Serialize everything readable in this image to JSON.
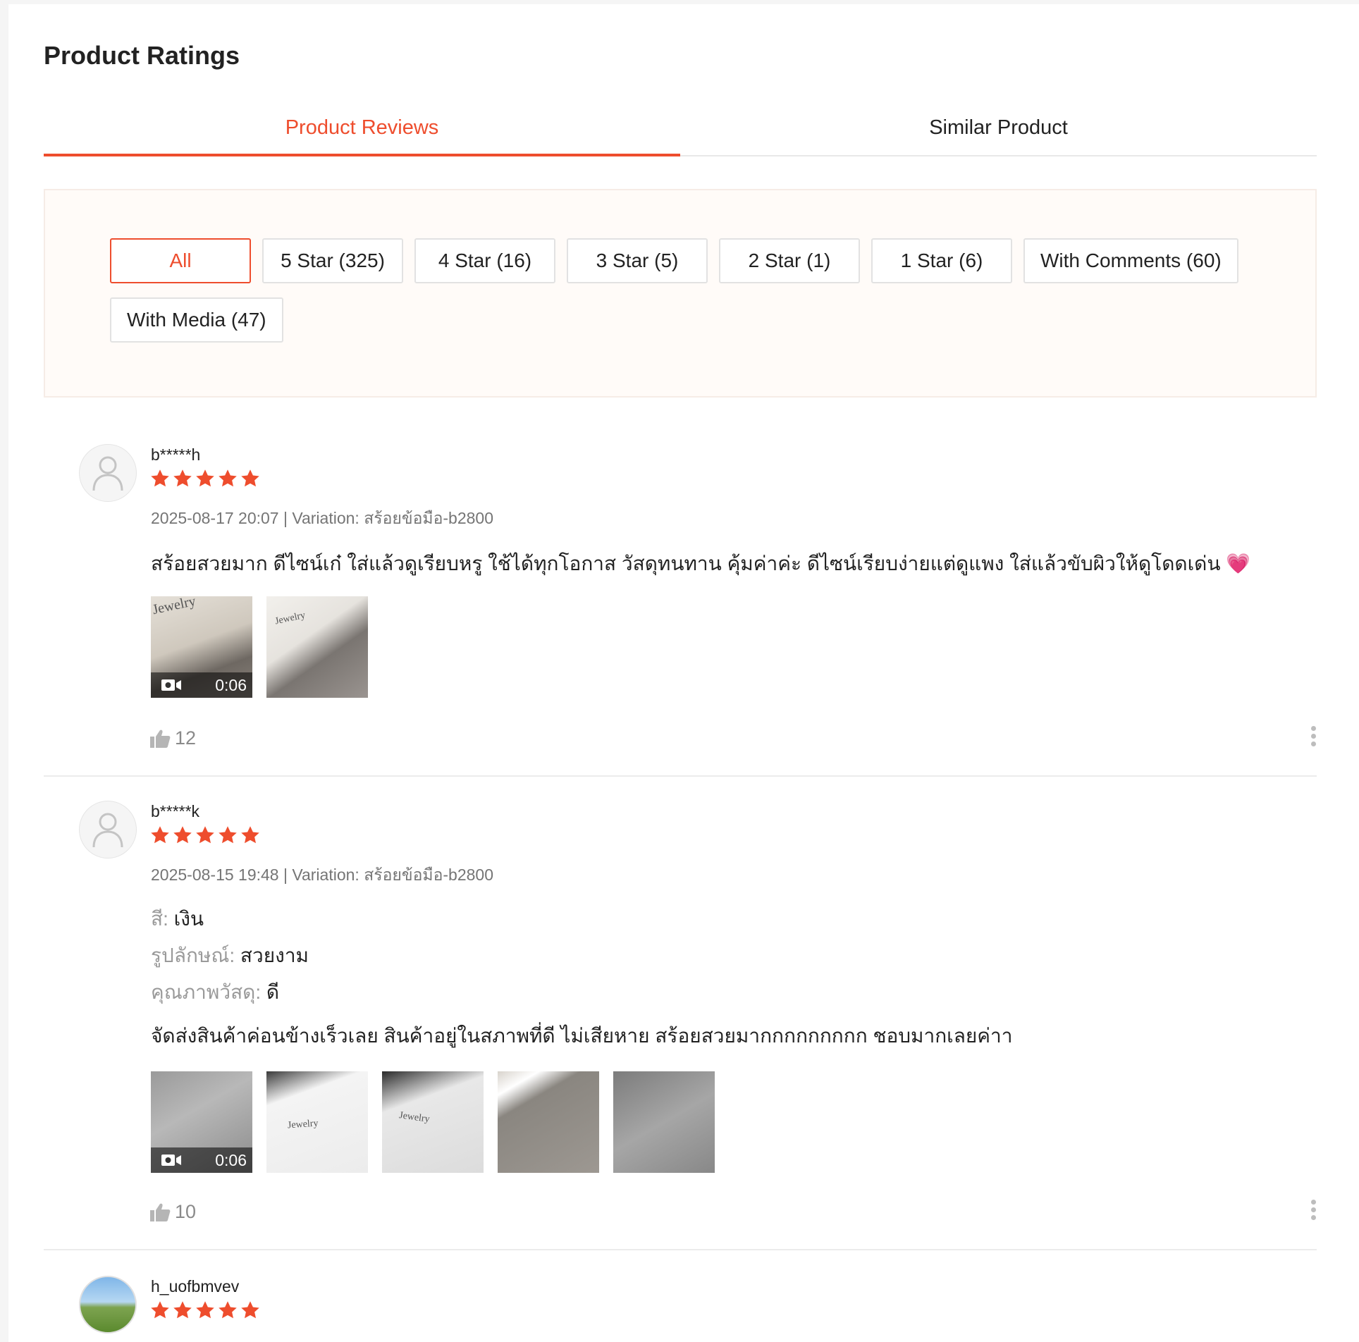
{
  "page": {
    "title": "Product Ratings"
  },
  "tabs": [
    {
      "label": "Product Reviews",
      "active": true
    },
    {
      "label": "Similar Product",
      "active": false
    }
  ],
  "filters": [
    {
      "label": "All",
      "active": true
    },
    {
      "label": "5 Star (325)"
    },
    {
      "label": "4 Star (16)"
    },
    {
      "label": "3 Star (5)"
    },
    {
      "label": "2 Star (1)"
    },
    {
      "label": "1 Star (6)"
    },
    {
      "label": "With Comments (60)"
    },
    {
      "label": "With Media (47)"
    }
  ],
  "colors": {
    "accent": "#ee4d2d",
    "star": "#ee4d2d",
    "muted": "#757575"
  },
  "reviews": [
    {
      "username": "b*****h",
      "rating": 5,
      "meta": "2025-08-17 20:07 | Variation: สร้อยข้อมือ-b2800",
      "text": "สร้อยสวยมาก ดีไซน์เก๋ ใส่แล้วดูเรียบหรู ใช้ได้ทุกโอกาส วัสดุทนทาน คุ้มค่าค่ะ  ดีไซน์เรียบง่ายแต่ดูแพง ใส่แล้วขับผิวให้ดูโดดเด่น 💗",
      "video_duration": "0:06",
      "thumb_brand": "Jewelry",
      "likes": "12"
    },
    {
      "username": "b*****k",
      "rating": 5,
      "meta": "2025-08-15 19:48 | Variation: สร้อยข้อมือ-b2800",
      "attributes": [
        {
          "key": "สี:",
          "value": "เงิน"
        },
        {
          "key": "รูปลักษณ์:",
          "value": "สวยงาม"
        },
        {
          "key": "คุณภาพวัสดุ:",
          "value": "ดี"
        }
      ],
      "text": "จัดส่งสินค้าค่อนข้างเร็วเลย สินค้าอยู่ในสภาพที่ดี ไม่เสียหาย สร้อยสวยมากกกกกกกกก ชอบมากเลยค่าา",
      "video_duration": "0:06",
      "thumb_brand": "Jewelry",
      "likes": "10"
    },
    {
      "username": "h_uofbmvev",
      "rating": 5
    }
  ]
}
